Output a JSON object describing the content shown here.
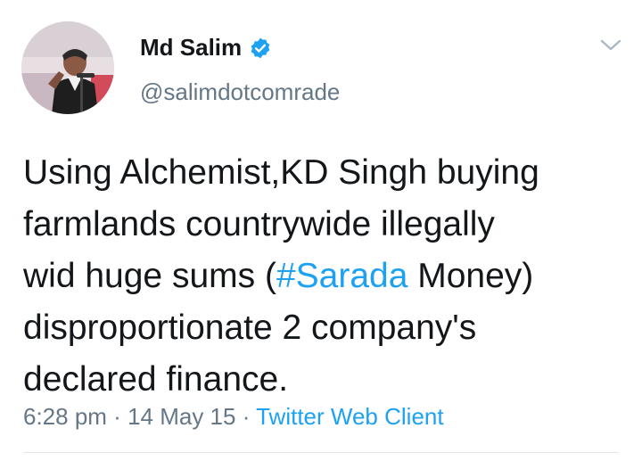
{
  "author": {
    "display_name": "Md Salim",
    "handle": "@salimdotcomrade",
    "verified": true
  },
  "tweet": {
    "lines": [
      "Using Alchemist,KD Singh buying",
      "farmlands countrywide illegally",
      {
        "before": "wid huge sums (",
        "hashtag": "#Sarada",
        "after": " Money)"
      },
      "disproportionate 2 company's",
      "declared finance."
    ]
  },
  "meta": {
    "time": "6:28 pm",
    "sep1": " · ",
    "date": "14 May 15",
    "sep2": " · ",
    "client": "Twitter Web Client"
  },
  "colors": {
    "link": "#1da1f2",
    "secondary_text": "#657786",
    "primary_text": "#14171a"
  },
  "icons": {
    "verified": "verified-badge-icon",
    "menu": "chevron-down-icon"
  }
}
